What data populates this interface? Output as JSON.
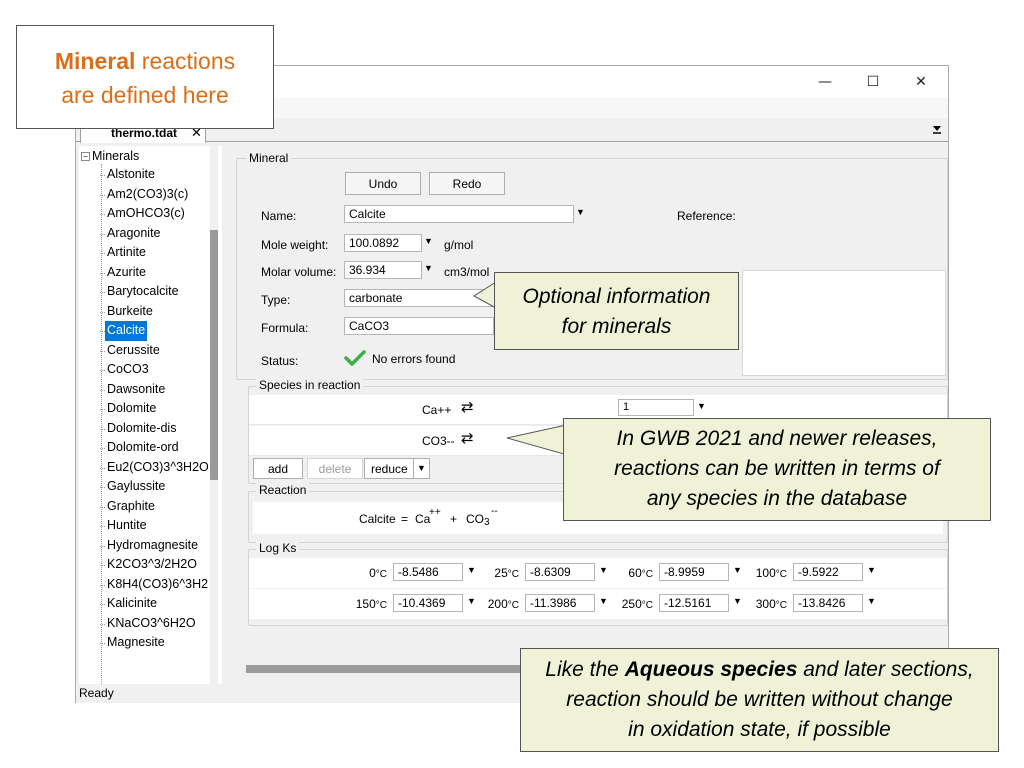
{
  "window": {
    "minimize_glyph": "—",
    "maximize_glyph": "☐",
    "close_glyph": "✕",
    "tab_label": "thermo.tdat",
    "tab_close": "✕",
    "status": "Ready"
  },
  "tree": {
    "root_label": "Minerals",
    "items": [
      "Alstonite",
      "Am2(CO3)3(c)",
      "AmOHCO3(c)",
      "Aragonite",
      "Artinite",
      "Azurite",
      "Barytocalcite",
      "Burkeite",
      "Calcite",
      "Cerussite",
      "CoCO3",
      "Dawsonite",
      "Dolomite",
      "Dolomite-dis",
      "Dolomite-ord",
      "Eu2(CO3)3^3H2O",
      "Gaylussite",
      "Graphite",
      "Huntite",
      "Hydromagnesite",
      "K2CO3^3/2H2O",
      "K8H4(CO3)6^3H2",
      "Kalicinite",
      "KNaCO3^6H2O",
      "Magnesite"
    ],
    "selected": "Calcite"
  },
  "mineral": {
    "group_label": "Mineral",
    "undo_label": "Undo",
    "redo_label": "Redo",
    "name_label": "Name:",
    "name_value": "Calcite",
    "mole_weight_label": "Mole weight:",
    "mole_weight_value": "100.0892",
    "mole_weight_unit": "g/mol",
    "molar_volume_label": "Molar volume:",
    "molar_volume_value": "36.934",
    "molar_volume_unit": "cm3/mol",
    "type_label": "Type:",
    "type_value": "carbonate",
    "formula_label": "Formula:",
    "formula_value": "CaCO3",
    "status_label": "Status:",
    "status_value": "No errors found",
    "reference_label": "Reference:"
  },
  "species": {
    "group_label": "Species in reaction",
    "rows": [
      {
        "name": "Ca++",
        "coef": "1"
      },
      {
        "name": "CO3--",
        "coef": ""
      }
    ],
    "add_label": "add",
    "delete_label": "delete",
    "reduce_label": "reduce"
  },
  "reaction": {
    "group_label": "Reaction",
    "lhs": "Calcite",
    "eq": "=",
    "sp1": "Ca",
    "sp1_charge": "++",
    "plus": "+",
    "sp2": "CO",
    "sp2_sub": "3",
    "sp2_charge": "--"
  },
  "logks": {
    "group_label": "Log Ks",
    "rows": [
      [
        {
          "t": "0",
          "v": "-8.5486"
        },
        {
          "t": "25",
          "v": "-8.6309"
        },
        {
          "t": "60",
          "v": "-8.9959"
        },
        {
          "t": "100",
          "v": "-9.5922"
        }
      ],
      [
        {
          "t": "150",
          "v": "-10.4369"
        },
        {
          "t": "200",
          "v": "-11.3986"
        },
        {
          "t": "250",
          "v": "-12.5161"
        },
        {
          "t": "300",
          "v": "-13.8426"
        }
      ]
    ],
    "unit": "°C"
  },
  "callouts": {
    "mineral_bold": "Mineral",
    "mineral_rest1": " reactions",
    "mineral_line2": "are defined here",
    "optional_line1": "Optional information",
    "optional_line2": "for minerals",
    "gwb_line1": "In GWB 2021 and newer releases,",
    "gwb_line2": "reactions can be written in terms of",
    "gwb_line3": "any species in the database",
    "aqueous_pre": "Like the ",
    "aqueous_bold": "Aqueous species",
    "aqueous_post": " and later sections,",
    "aqueous_line2": "reaction should be written without change",
    "aqueous_line3": "in oxidation state, if possible"
  },
  "colors": {
    "selection": "#0078d7",
    "callout_fill": "#f0f2d8",
    "callout_accent": "#d96f1a",
    "status_ok": "#3cb043"
  }
}
